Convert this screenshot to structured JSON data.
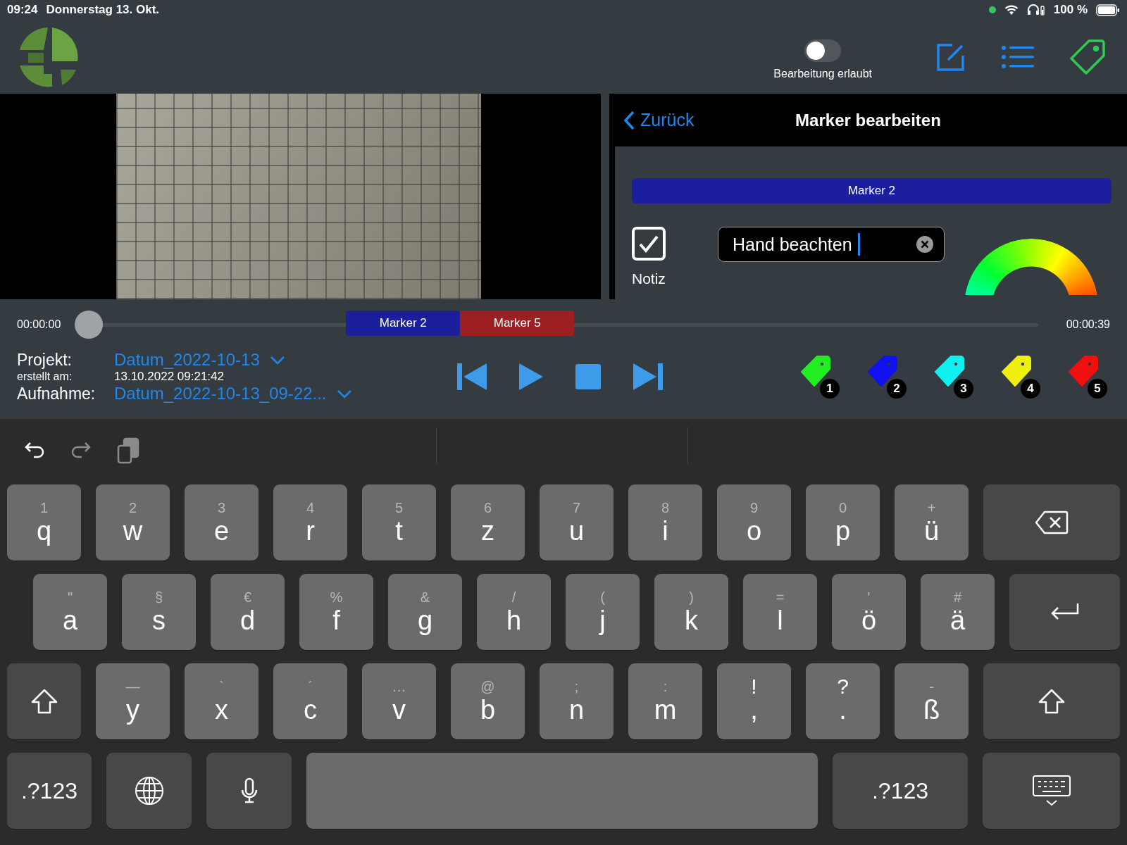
{
  "status_bar": {
    "time": "09:24",
    "date": "Donnerstag 13. Okt.",
    "battery": "100 %"
  },
  "header": {
    "edit_toggle": {
      "label": "Bearbeitung erlaubt",
      "on": false
    }
  },
  "marker_panel": {
    "back": "Zurück",
    "title": "Marker bearbeiten",
    "marker_name": "Marker 2",
    "note": {
      "label": "Notiz",
      "checked": true
    },
    "text_field": {
      "value": "Hand beachten"
    }
  },
  "timeline": {
    "start": "00:00:00",
    "end": "00:00:39",
    "level": 0,
    "markers": [
      {
        "label": "Marker 2",
        "color": "#1b1f9c"
      },
      {
        "label": "Marker 5",
        "color": "#9c1f22"
      }
    ]
  },
  "recording": {
    "project_label": "Projekt:",
    "project": "Datum_2022-10-13",
    "created_label": "erstellt am:",
    "created": "13.10.2022 09:21:42",
    "recording_label": "Aufnahme:",
    "recording": "Datum_2022-10-13_09-22..."
  },
  "tags": [
    {
      "number": "1",
      "color": "#22ee22"
    },
    {
      "number": "2",
      "color": "#1010f0"
    },
    {
      "number": "3",
      "color": "#10f0f0"
    },
    {
      "number": "4",
      "color": "#f0f010"
    },
    {
      "number": "5",
      "color": "#f01010"
    }
  ],
  "keyboard": {
    "rows": [
      [
        {
          "kind": "char",
          "label": "q",
          "hint": "1"
        },
        {
          "kind": "char",
          "label": "w",
          "hint": "2"
        },
        {
          "kind": "char",
          "label": "e",
          "hint": "3"
        },
        {
          "kind": "char",
          "label": "r",
          "hint": "4"
        },
        {
          "kind": "char",
          "label": "t",
          "hint": "5"
        },
        {
          "kind": "char",
          "label": "z",
          "hint": "6"
        },
        {
          "kind": "char",
          "label": "u",
          "hint": "7"
        },
        {
          "kind": "char",
          "label": "i",
          "hint": "8"
        },
        {
          "kind": "char",
          "label": "o",
          "hint": "9"
        },
        {
          "kind": "char",
          "label": "p",
          "hint": "0"
        },
        {
          "kind": "char",
          "label": "ü",
          "hint": "+"
        },
        {
          "kind": "backspace"
        }
      ],
      [
        {
          "kind": "char",
          "label": "a",
          "hint": "\""
        },
        {
          "kind": "char",
          "label": "s",
          "hint": "§"
        },
        {
          "kind": "char",
          "label": "d",
          "hint": "€"
        },
        {
          "kind": "char",
          "label": "f",
          "hint": "%"
        },
        {
          "kind": "char",
          "label": "g",
          "hint": "&"
        },
        {
          "kind": "char",
          "label": "h",
          "hint": "/"
        },
        {
          "kind": "char",
          "label": "j",
          "hint": "("
        },
        {
          "kind": "char",
          "label": "k",
          "hint": ")"
        },
        {
          "kind": "char",
          "label": "l",
          "hint": "="
        },
        {
          "kind": "char",
          "label": "ö",
          "hint": "'"
        },
        {
          "kind": "char",
          "label": "ä",
          "hint": "#"
        },
        {
          "kind": "return"
        }
      ],
      [
        {
          "kind": "shift"
        },
        {
          "kind": "char",
          "label": "y",
          "hint": "—"
        },
        {
          "kind": "char",
          "label": "x",
          "hint": "`"
        },
        {
          "kind": "char",
          "label": "c",
          "hint": "´"
        },
        {
          "kind": "char",
          "label": "v",
          "hint": "…"
        },
        {
          "kind": "char",
          "label": "b",
          "hint": "@"
        },
        {
          "kind": "char",
          "label": "n",
          "hint": ";"
        },
        {
          "kind": "char",
          "label": "m",
          "hint": ":"
        },
        {
          "kind": "punct",
          "label": ",",
          "hint": "!"
        },
        {
          "kind": "punct",
          "label": ".",
          "hint": "?"
        },
        {
          "kind": "char",
          "label": "ß",
          "hint": "-"
        },
        {
          "kind": "shift"
        }
      ],
      [
        {
          "kind": "mode",
          "label": ".?123"
        },
        {
          "kind": "globe"
        },
        {
          "kind": "mic"
        },
        {
          "kind": "space"
        },
        {
          "kind": "mode",
          "label": ".?123"
        },
        {
          "kind": "hide"
        }
      ]
    ]
  }
}
